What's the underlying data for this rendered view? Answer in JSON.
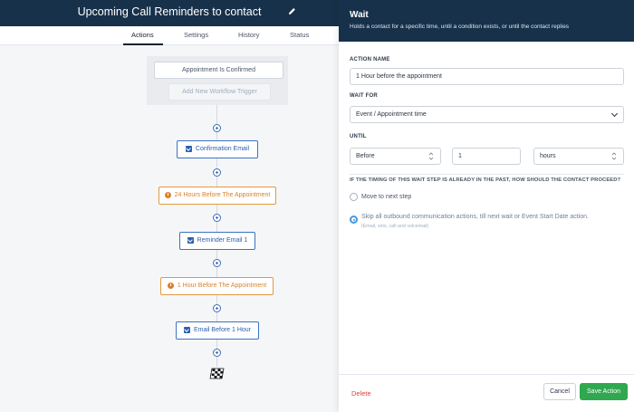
{
  "workflow": {
    "title": "Upcoming Call Reminders to contact",
    "tabs": [
      {
        "label": "Actions",
        "active": true
      },
      {
        "label": "Settings",
        "active": false
      },
      {
        "label": "History",
        "active": false
      },
      {
        "label": "Status",
        "active": false
      }
    ],
    "trigger": "Appointment Is Confirmed",
    "add_trigger": "Add New Workflow Trigger",
    "steps": [
      {
        "type": "email",
        "icon": "envelope-icon",
        "label": "Confirmation Email"
      },
      {
        "type": "wait",
        "icon": "clock-icon",
        "label": "24 Hours Before The Appointment"
      },
      {
        "type": "email",
        "icon": "envelope-icon",
        "label": "Reminder Email 1"
      },
      {
        "type": "wait",
        "icon": "clock-icon",
        "label": "1 Hour Before The Appointment"
      },
      {
        "type": "email",
        "icon": "envelope-icon",
        "label": "Email Before 1 Hour"
      }
    ],
    "end_icon": "checkered-flag-icon"
  },
  "panel": {
    "title": "Wait",
    "subtitle": "Holds a contact for a specific time, until a condition exists, or until the contact replies",
    "action_name_label": "ACTION NAME",
    "action_name_value": "1 Hour before the appointment",
    "wait_for_label": "WAIT FOR",
    "wait_for_value": "Event / Appointment time",
    "until_label": "UNTIL",
    "until_when": "Before",
    "until_amount": "1",
    "until_unit": "hours",
    "question": "IF THE TIMING OF THIS WAIT STEP IS ALREADY IN THE PAST, HOW SHOULD THE CONTACT PROCEED?",
    "option_move": "Move to next step",
    "option_skip": "Skip all outbound communication actions, till next wait or Event Start Date action.",
    "option_skip_note": "(Email, sms, call and voicemail)",
    "selected_option": "skip",
    "delete_label": "Delete",
    "cancel_label": "Cancel",
    "save_label": "Save Action"
  },
  "colors": {
    "header_bg": "#17314a",
    "email_accent": "#2b5fb0",
    "wait_accent": "#d9822b",
    "save_green": "#2fa84f",
    "delete_red": "#e53e3e"
  }
}
